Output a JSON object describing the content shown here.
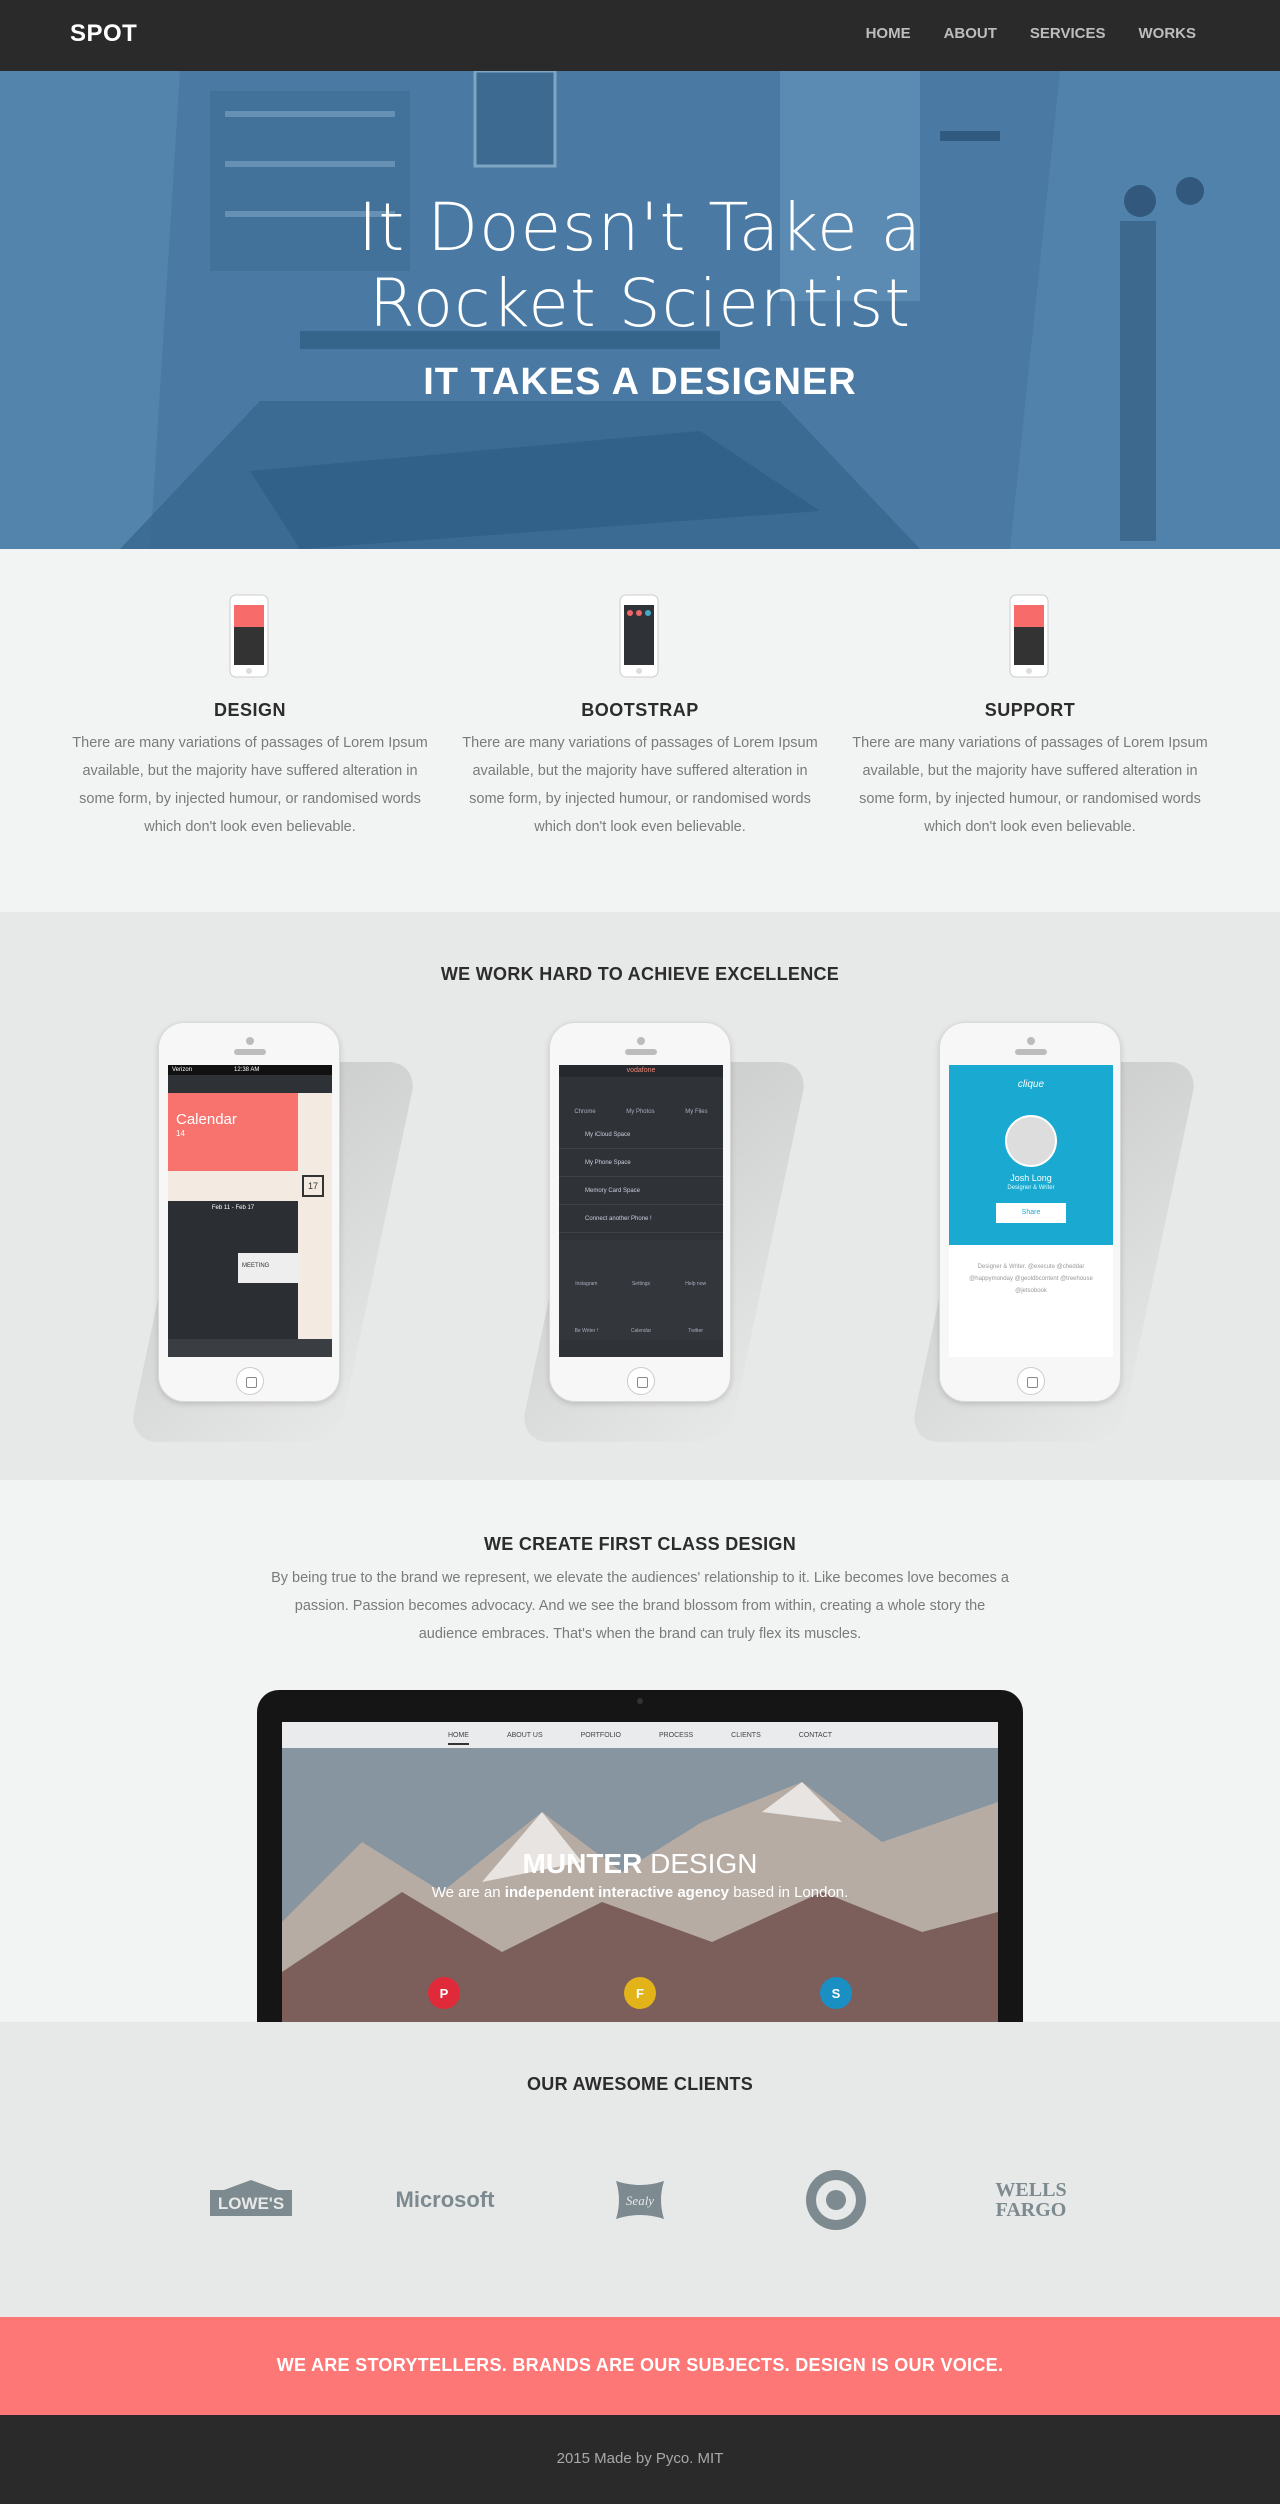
{
  "nav": {
    "brand": "SPOT",
    "items": [
      {
        "label": "HOME"
      },
      {
        "label": "ABOUT"
      },
      {
        "label": "SERVICES"
      },
      {
        "label": "WORKS"
      }
    ]
  },
  "hero": {
    "line1": "It Doesn't Take a",
    "line2": "Rocket Scientist",
    "subtitle": "IT TAKES A DESIGNER"
  },
  "features": [
    {
      "title": "DESIGN",
      "text": "There are many variations of passages of Lorem Ipsum available, but the majority have suffered alteration in some form, by injected humour, or randomised words which don't look even believable."
    },
    {
      "title": "BOOTSTRAP",
      "text": "There are many variations of passages of Lorem Ipsum available, but the majority have suffered alteration in some form, by injected humour, or randomised words which don't look even believable."
    },
    {
      "title": "SUPPORT",
      "text": "There are many variations of passages of Lorem Ipsum available, but the majority have suffered alteration in some form, by injected humour, or randomised words which don't look even believable."
    }
  ],
  "excellence": {
    "title": "WE WORK HARD TO ACHIEVE EXCELLENCE",
    "phone1": {
      "carrier": "Verizon",
      "time": "12:38 AM",
      "app_title": "Calendar",
      "day": "14",
      "week": "Feb 11 - Feb 17",
      "meeting": "MEETING",
      "badge": "17"
    },
    "phone2": {
      "carrier": "vodafone",
      "apps": [
        "Chrome",
        "My Photos",
        "My Files"
      ],
      "rows": [
        "My iCloud Space",
        "My Phone Space",
        "Memory Card Space",
        "Connect another Phone !"
      ],
      "grid": [
        "Instagram",
        "Settings",
        "Help now",
        "Be Writer !",
        "Calendar",
        "Twitter"
      ]
    },
    "phone3": {
      "app": "clique",
      "name": "Josh Long",
      "role": "Designer & Writer",
      "button": "Share",
      "bio": "Designer & Writer. @execute @cheddar @happymonday @geoldbcontent @treehouse @jetsobook"
    }
  },
  "design": {
    "title": "WE CREATE FIRST CLASS DESIGN",
    "text": "By being true to the brand we represent, we elevate the audiences' relationship to it. Like becomes love becomes a passion. Passion becomes advocacy. And we see the brand blossom from within, creating a whole story the audience embraces. That's when the brand can truly flex its muscles.",
    "screen": {
      "nav": [
        "HOME",
        "ABOUT US",
        "PORTFOLIO",
        "PROCESS",
        "CLIENTS",
        "CONTACT"
      ],
      "title_bold": "MUNTER",
      "title_light": "DESIGN",
      "sub_pre": "We are an",
      "sub_bold": "independent interactive agency",
      "sub_post": "based in London.",
      "badges": [
        "P",
        "F",
        "S"
      ]
    }
  },
  "clients": {
    "title": "OUR AWESOME CLIENTS",
    "logos": [
      "LOWE'S",
      "Microsoft",
      "Sealy",
      "Target",
      "WELLS FARGO"
    ]
  },
  "banner": {
    "text": "WE ARE STORYTELLERS. BRANDS ARE OUR SUBJECTS. DESIGN IS OUR VOICE."
  },
  "footer": {
    "text": "2015 Made by Pyco. MIT"
  },
  "colors": {
    "dark": "#2b2a2a",
    "coral": "#fd7776",
    "hero_blue": "#4a7aa3",
    "light": "#f2f3f3",
    "grey": "#e7e8e8",
    "cyan": "#1aa9d0"
  }
}
